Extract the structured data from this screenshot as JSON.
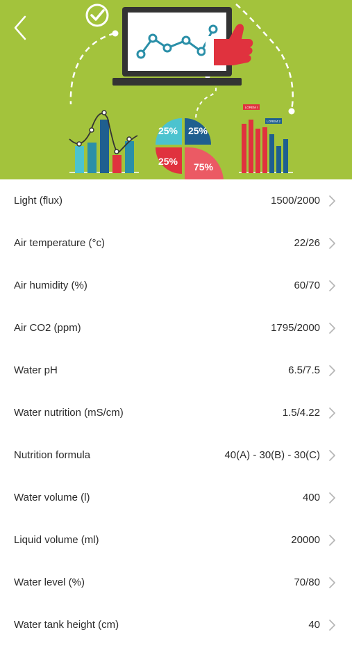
{
  "header": {
    "back_icon": "chevron-left-icon",
    "check_icon": "check-circle-icon",
    "pie_labels": [
      "25%",
      "25%",
      "25%",
      "75%"
    ],
    "legend_tags": [
      "LOREM I",
      "LOREM 2"
    ],
    "colors": {
      "background": "#a3c33c",
      "teal": "#2a8fa8",
      "navy": "#1f5f8f",
      "cyan": "#4cc3cf",
      "red": "#e0323e",
      "light_red": "#eb5a64"
    }
  },
  "settings": {
    "chevron_icon": "chevron-right-icon",
    "items": [
      {
        "label": "Light (flux)",
        "value": "1500/2000"
      },
      {
        "label": "Air temperature (°c)",
        "value": "22/26"
      },
      {
        "label": "Air humidity (%)",
        "value": "60/70"
      },
      {
        "label": "Air CO2 (ppm)",
        "value": "1795/2000"
      },
      {
        "label": "Water pH",
        "value": "6.5/7.5"
      },
      {
        "label": "Water nutrition (mS/cm)",
        "value": "1.5/4.22"
      },
      {
        "label": "Nutrition formula",
        "value": "40(A) - 30(B) - 30(C)"
      },
      {
        "label": "Water volume (l)",
        "value": "400"
      },
      {
        "label": "Liquid volume (ml)",
        "value": "20000"
      },
      {
        "label": "Water level (%)",
        "value": "70/80"
      },
      {
        "label": "Water tank height (cm)",
        "value": "40"
      }
    ]
  }
}
